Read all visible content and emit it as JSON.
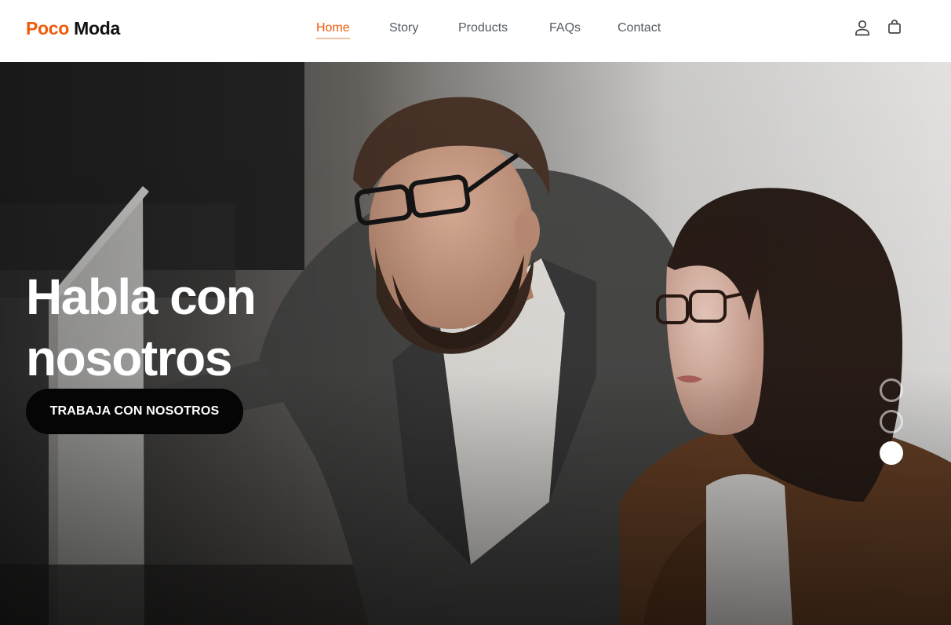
{
  "brand": {
    "part1": "Poco",
    "part2": "Moda",
    "accent_color": "#f05a0a"
  },
  "nav": {
    "items": [
      {
        "label": "Home",
        "active": true
      },
      {
        "label": "Story",
        "active": false
      },
      {
        "label": "Products",
        "active": false
      },
      {
        "label": "FAQs",
        "active": false
      },
      {
        "label": "Contact",
        "active": false
      }
    ]
  },
  "header_icons": {
    "account": "user-icon",
    "cart": "shopping-bag-icon"
  },
  "hero": {
    "title_line1": "Habla con",
    "title_line2": "nosotros",
    "cta_label": "TRABAJA CON NOSOTROS",
    "slides_total": 3,
    "active_slide": 3
  }
}
